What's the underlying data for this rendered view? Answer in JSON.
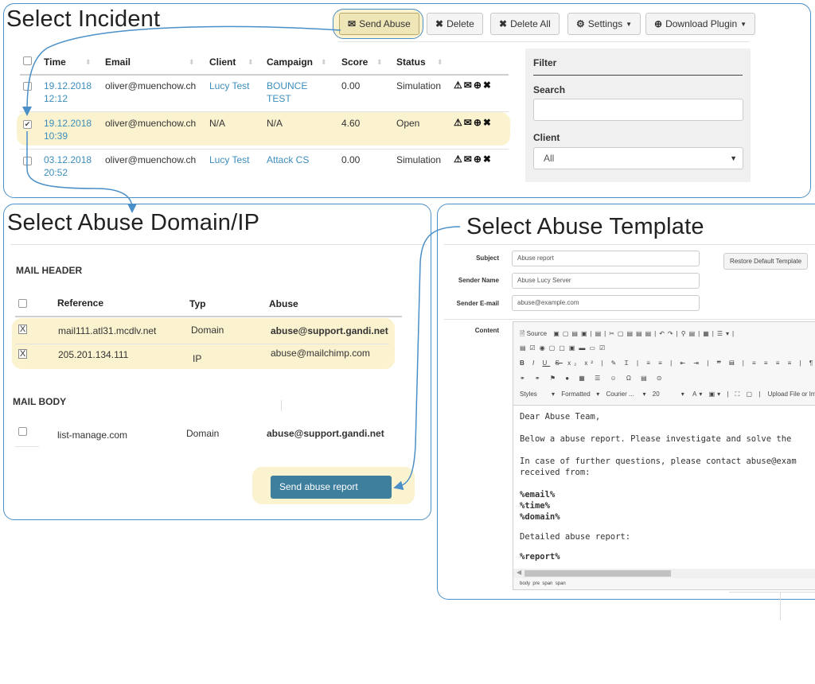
{
  "incident": {
    "title": "Select Incident",
    "toolbar": {
      "send_abuse": "Send Abuse",
      "delete": "Delete",
      "delete_all": "Delete All",
      "settings": "Settings",
      "download_plugin": "Download Plugin"
    },
    "columns": [
      "Time",
      "Email",
      "Client",
      "Campaign",
      "Score",
      "Status"
    ],
    "rows": [
      {
        "date": "19.12.2018",
        "time": "12:12",
        "email": "oliver@muenchow.ch",
        "client": "Lucy Test",
        "campaign_1": "BOUNCE",
        "campaign_2": "TEST",
        "score": "0.00",
        "status": "Simulation",
        "checked": false
      },
      {
        "date": "19.12.2018",
        "time": "10:39",
        "email": "oliver@muenchow.ch",
        "client": "N/A",
        "campaign_1": "N/A",
        "campaign_2": "",
        "score": "4.60",
        "status": "Open",
        "checked": true
      },
      {
        "date": "03.12.2018",
        "time": "20:52",
        "email": "oliver@muenchow.ch",
        "client": "Lucy Test",
        "campaign_1": "Attack CS",
        "campaign_2": "",
        "score": "0.00",
        "status": "Simulation",
        "checked": false
      }
    ],
    "actions_glyphs": "⚠✉⊕✖",
    "filter": {
      "title": "Filter",
      "search_label": "Search",
      "search_value": "",
      "client_label": "Client",
      "client_selected": "All"
    }
  },
  "domain": {
    "title": "Select Abuse Domain/IP",
    "mail_header_label": "MAIL HEADER",
    "columns": [
      "Reference",
      "Typ",
      "Abuse"
    ],
    "header_rows": [
      {
        "reference": "mail111.atl31.mcdlv.net",
        "type": "Domain",
        "abuse": "abuse@support.gandi.net",
        "mark": "X"
      },
      {
        "reference": "205.201.134.111",
        "type": "IP",
        "abuse": "abuse@mailchimp.com",
        "mark": "X"
      }
    ],
    "mail_body_label": "MAIL BODY",
    "body_rows": [
      {
        "reference": "list-manage.com",
        "type": "Domain",
        "abuse": "abuse@support.gandi.net"
      }
    ],
    "send_button": "Send abuse report"
  },
  "template": {
    "title": "Select Abuse Template",
    "subject_label": "Subject",
    "subject_value": "Abuse report",
    "restore_button": "Restore Default Template",
    "sender_name_label": "Sender Name",
    "sender_name_value": "Abuse Lucy Server",
    "sender_email_label": "Sender E-mail",
    "sender_email_value": "abuse@example.com",
    "content_label": "Content",
    "toolbar": {
      "source": "Source",
      "styles": "Styles",
      "format": "Formatted",
      "font": "Courier ...",
      "size": "20",
      "upload": "Upload File or Image"
    },
    "body": {
      "greeting": "Dear Abuse Team,",
      "line1": "Below a abuse report. Please investigate and solve the",
      "line2": "In case of further questions, please contact abuse@exam",
      "line3": "received from:",
      "var_email": "%email%",
      "var_time": "%time%",
      "var_domain": "%domain%",
      "detail_label": "Detailed abuse report:",
      "var_report": "%report%"
    },
    "status_path": [
      "body",
      "pre",
      "span",
      "span"
    ]
  },
  "colors": {
    "accent_border": "#4a8fc7",
    "highlight": "#fbf3cf",
    "link": "#3c8dbc",
    "send_button": "#3f7f9e"
  }
}
